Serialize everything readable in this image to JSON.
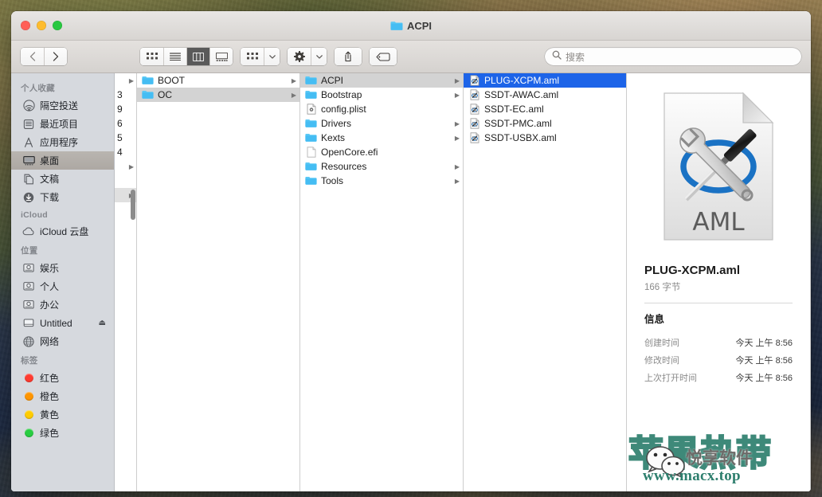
{
  "window": {
    "title": "ACPI",
    "title_icon": "folder-icon",
    "traffic_lights": [
      {
        "name": "close",
        "color": "#ff5f57"
      },
      {
        "name": "minimize",
        "color": "#febc2e"
      },
      {
        "name": "zoom",
        "color": "#28c840"
      }
    ]
  },
  "toolbar": {
    "back_label": "‹",
    "forward_label": "›",
    "view_modes": [
      {
        "name": "icon-view",
        "active": false
      },
      {
        "name": "list-view",
        "active": false
      },
      {
        "name": "column-view",
        "active": true
      },
      {
        "name": "gallery-view",
        "active": false
      }
    ],
    "group_button": "arrange-icon",
    "action_button": "gear-icon",
    "share_button": "share-icon",
    "tag_button": "tag-icon",
    "chevron": "ˇ"
  },
  "search": {
    "placeholder": "搜索",
    "value": "",
    "icon": "search-icon"
  },
  "sidebar": {
    "sections": [
      {
        "header": "个人收藏",
        "items": [
          {
            "label": "隔空投送",
            "icon": "airdrop-icon",
            "selected": false
          },
          {
            "label": "最近项目",
            "icon": "recents-icon",
            "selected": false
          },
          {
            "label": "应用程序",
            "icon": "applications-icon",
            "selected": false
          },
          {
            "label": "桌面",
            "icon": "desktop-icon",
            "selected": true
          },
          {
            "label": "文稿",
            "icon": "documents-icon",
            "selected": false
          },
          {
            "label": "下载",
            "icon": "downloads-icon",
            "selected": false
          }
        ]
      },
      {
        "header": "iCloud",
        "items": [
          {
            "label": "iCloud 云盘",
            "icon": "icloud-icon",
            "selected": false
          }
        ]
      },
      {
        "header": "位置",
        "items": [
          {
            "label": "娱乐",
            "icon": "harddisk-icon",
            "selected": false
          },
          {
            "label": "个人",
            "icon": "harddisk-icon",
            "selected": false
          },
          {
            "label": "办公",
            "icon": "harddisk-icon",
            "selected": false
          },
          {
            "label": "Untitled",
            "icon": "removable-disk-icon",
            "selected": false,
            "eject": "⏏"
          },
          {
            "label": "网络",
            "icon": "network-icon",
            "selected": false
          }
        ]
      },
      {
        "header": "标签",
        "items": [
          {
            "label": "红色",
            "icon": "tag-dot-icon",
            "color": "#ff3b30",
            "selected": false
          },
          {
            "label": "橙色",
            "icon": "tag-dot-icon",
            "color": "#ff9500",
            "selected": false
          },
          {
            "label": "黄色",
            "icon": "tag-dot-icon",
            "color": "#ffcc00",
            "selected": false
          },
          {
            "label": "绿色",
            "icon": "tag-dot-icon",
            "color": "#28cd41",
            "selected": false
          }
        ]
      }
    ]
  },
  "columns": {
    "partial": {
      "rows": [
        {
          "label": "",
          "arrow": true
        },
        {
          "label": "3",
          "arrow": false
        },
        {
          "label": "9",
          "arrow": false
        },
        {
          "label": "6",
          "arrow": false
        },
        {
          "label": "5",
          "arrow": false
        },
        {
          "label": "4",
          "arrow": false
        },
        {
          "label": "",
          "arrow": true
        },
        {
          "label": "",
          "arrow": false
        },
        {
          "label": "",
          "arrow": true
        }
      ]
    },
    "column1": {
      "items": [
        {
          "label": "BOOT",
          "icon": "folder-icon",
          "arrow": true,
          "selected": "none"
        },
        {
          "label": "OC",
          "icon": "folder-icon",
          "arrow": true,
          "selected": "gray"
        }
      ]
    },
    "column2": {
      "items": [
        {
          "label": "ACPI",
          "icon": "folder-icon",
          "arrow": true,
          "selected": "gray"
        },
        {
          "label": "Bootstrap",
          "icon": "folder-icon",
          "arrow": true,
          "selected": "none"
        },
        {
          "label": "config.plist",
          "icon": "plist-file-icon",
          "arrow": false,
          "selected": "none"
        },
        {
          "label": "Drivers",
          "icon": "folder-icon",
          "arrow": true,
          "selected": "none"
        },
        {
          "label": "Kexts",
          "icon": "folder-icon",
          "arrow": true,
          "selected": "none"
        },
        {
          "label": "OpenCore.efi",
          "icon": "generic-file-icon",
          "arrow": false,
          "selected": "none"
        },
        {
          "label": "Resources",
          "icon": "folder-icon",
          "arrow": true,
          "selected": "none"
        },
        {
          "label": "Tools",
          "icon": "folder-icon",
          "arrow": true,
          "selected": "none"
        }
      ]
    },
    "column3": {
      "items": [
        {
          "label": "PLUG-XCPM.aml",
          "icon": "aml-file-icon",
          "arrow": false,
          "selected": "blue"
        },
        {
          "label": "SSDT-AWAC.aml",
          "icon": "aml-file-icon",
          "arrow": false,
          "selected": "none"
        },
        {
          "label": "SSDT-EC.aml",
          "icon": "aml-file-icon",
          "arrow": false,
          "selected": "none"
        },
        {
          "label": "SSDT-PMC.aml",
          "icon": "aml-file-icon",
          "arrow": false,
          "selected": "none"
        },
        {
          "label": "SSDT-USBX.aml",
          "icon": "aml-file-icon",
          "arrow": false,
          "selected": "none"
        }
      ]
    }
  },
  "preview": {
    "icon": "aml-document-icon",
    "icon_caption": "AML",
    "filename": "PLUG-XCPM.aml",
    "size": "166 字节",
    "section_title": "信息",
    "metadata": [
      {
        "key": "创建时间",
        "value": "今天 上午 8:56"
      },
      {
        "key": "修改时间",
        "value": "今天 上午 8:56"
      },
      {
        "key": "上次打开时间",
        "value": "今天 上午 8:56"
      }
    ]
  },
  "watermark": {
    "big_text": "苹果热带",
    "sub_text": "悦享软件",
    "url": "www.macx.top",
    "icon": "wechat-icon",
    "color": "#2e7f6e"
  }
}
